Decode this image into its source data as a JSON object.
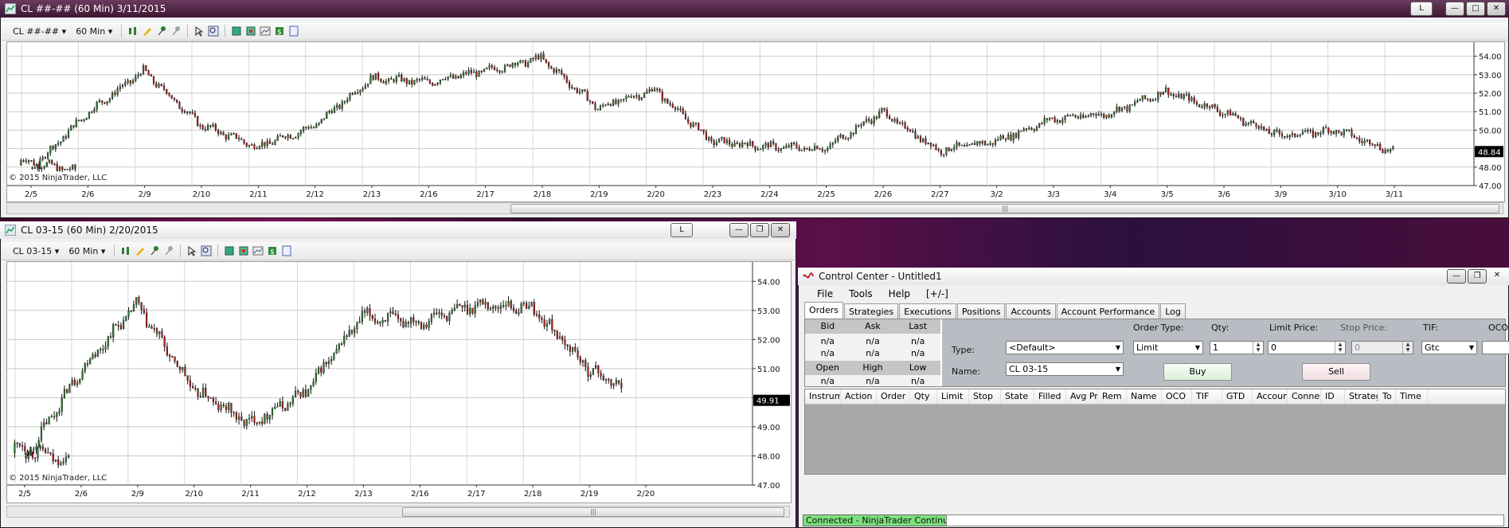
{
  "colors": {
    "up": "#2e7d32",
    "down": "#b71c1c",
    "wick": "#111111",
    "grid": "#c8c8c8",
    "vgrid": "#d8d8d8"
  },
  "top_window": {
    "title": "CL ##-## (60 Min)  3/11/2015",
    "l_button": "L",
    "toolbar": {
      "instrument": "CL ##-##",
      "interval": "60 Min",
      "icons": [
        "candle-style-icon",
        "pencil-draw-icon",
        "pin-icon",
        "push-pin-icon",
        "cursor-icon",
        "zoom-icon",
        "indicator-icon",
        "strategy-icon",
        "chart-properties-icon",
        "dollar-icon",
        "window-icon"
      ]
    },
    "copyright": "© 2015 NinjaTrader, LLC",
    "y_ticks": [
      "54.00",
      "53.00",
      "52.00",
      "51.00",
      "50.00",
      "49.00",
      "48.00",
      "47.00"
    ],
    "price_label": "48.84",
    "x_ticks": [
      "2/5",
      "2/6",
      "2/9",
      "2/10",
      "2/11",
      "2/12",
      "2/13",
      "2/16",
      "2/17",
      "2/18",
      "2/19",
      "2/20",
      "2/23",
      "2/24",
      "2/25",
      "2/26",
      "2/27",
      "3/2",
      "3/3",
      "3/4",
      "3/5",
      "3/6",
      "3/9",
      "3/10",
      "3/11"
    ]
  },
  "left_window": {
    "title": "CL 03-15 (60 Min)  2/20/2015",
    "l_button": "L",
    "toolbar": {
      "instrument": "CL 03-15",
      "interval": "60 Min"
    },
    "copyright": "© 2015 NinjaTrader, LLC",
    "y_ticks": [
      "54.00",
      "53.00",
      "52.00",
      "51.00",
      "50.00",
      "49.00",
      "48.00",
      "47.00"
    ],
    "price_label": "49.91",
    "x_ticks": [
      "2/5",
      "2/6",
      "2/9",
      "2/10",
      "2/11",
      "2/12",
      "2/13",
      "2/16",
      "2/17",
      "2/18",
      "2/19",
      "2/20"
    ]
  },
  "chart_data": [
    {
      "type": "candlestick",
      "title": "CL ##-## (60 Min)  3/11/2015",
      "ylim": [
        47,
        54.5
      ],
      "x": [
        "2/5",
        "2/6",
        "2/9",
        "2/10",
        "2/11",
        "2/12",
        "2/13",
        "2/16",
        "2/17",
        "2/18",
        "2/19",
        "2/20",
        "2/23",
        "2/24",
        "2/25",
        "2/26",
        "2/27",
        "3/2",
        "3/3",
        "3/4",
        "3/5",
        "3/6",
        "3/9",
        "3/10",
        "3/11"
      ],
      "close": [
        47.8,
        50.9,
        53.2,
        50.3,
        49.1,
        50.2,
        52.8,
        52.6,
        53.2,
        53.9,
        51.2,
        52.2,
        49.4,
        49.1,
        49.0,
        51.0,
        48.9,
        49.4,
        50.6,
        50.9,
        52.1,
        51.0,
        49.7,
        50.0,
        48.84
      ]
    },
    {
      "type": "candlestick",
      "title": "CL 03-15 (60 Min)  2/20/2015",
      "ylim": [
        47,
        54.5
      ],
      "x": [
        "2/5",
        "2/6",
        "2/9",
        "2/10",
        "2/11",
        "2/12",
        "2/13",
        "2/16",
        "2/17",
        "2/18",
        "2/19",
        "2/20"
      ],
      "close": [
        47.8,
        50.9,
        53.2,
        50.3,
        49.1,
        50.2,
        52.8,
        52.6,
        53.2,
        53.1,
        51.0,
        49.91
      ]
    }
  ],
  "control_center": {
    "title": "Control Center - Untitled1",
    "menu": [
      "File",
      "Tools",
      "Help",
      "[+/-]"
    ],
    "tabs": [
      "Orders",
      "Strategies",
      "Executions",
      "Positions",
      "Accounts",
      "Account Performance",
      "Log"
    ],
    "quote": {
      "headers1": [
        "Bid",
        "Ask",
        "Last"
      ],
      "row1": [
        "n/a",
        "n/a",
        "n/a"
      ],
      "row2": [
        "n/a",
        "n/a",
        "n/a"
      ],
      "headers2": [
        "Open",
        "High",
        "Low"
      ],
      "row3": [
        "n/a",
        "n/a",
        "n/a"
      ]
    },
    "order": {
      "type_label": "Type:",
      "type_value": "<Default>",
      "name_label": "Name:",
      "name_value": "CL 03-15",
      "order_type_label": "Order Type:",
      "order_type_value": "Limit",
      "qty_label": "Qty:",
      "qty_value": "1",
      "limit_label": "Limit Price:",
      "limit_value": "0",
      "stop_label": "Stop Price:",
      "stop_value": "0",
      "tif_label": "TIF:",
      "tif_value": "Gtc",
      "oco_label": "OCO:",
      "oco_value": "",
      "buy": "Buy",
      "sell": "Sell"
    },
    "grid_headers": [
      "Instrum",
      "Action",
      "Order",
      "Qty",
      "Limit",
      "Stop",
      "State",
      "Filled",
      "Avg Pri",
      "Rem",
      "Name",
      "OCO",
      "TIF",
      "GTD",
      "Accoun",
      "Conne",
      "ID",
      "Strateg",
      "To",
      "Time"
    ],
    "status": "Connected - NinjaTrader Continuum"
  }
}
